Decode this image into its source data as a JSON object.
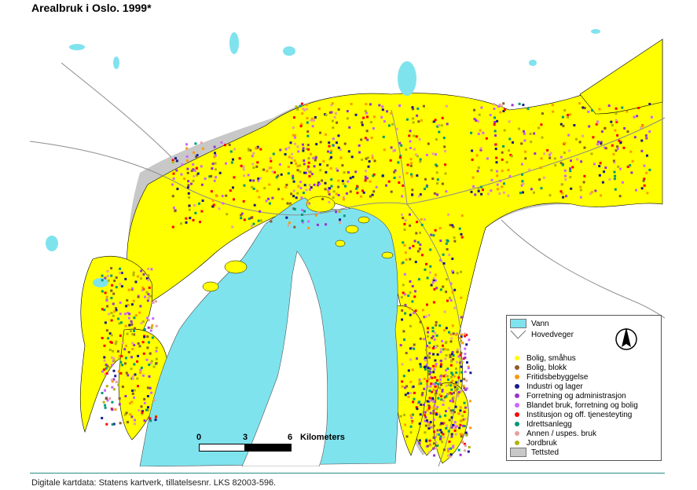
{
  "title": "Arealbruk i Oslo. 1999*",
  "footer": "Digitale kartdata: Statens kartverk, tillatelsesnr. LKS 82003-596.",
  "colors": {
    "water": "#7fe3ee",
    "urban": "#c8c8c8",
    "road": "#9a9a9a",
    "rule": "#2a8a86"
  },
  "legend": {
    "water": "Vann",
    "roads": "Hovedveger",
    "items": [
      {
        "label": "Bolig, småhus",
        "color": "#ffff00"
      },
      {
        "label": "Bolig, blokk",
        "color": "#8b5a2b"
      },
      {
        "label": "Fritidsbebyggelse",
        "color": "#ff9900"
      },
      {
        "label": "Industri og lager",
        "color": "#1a1a8c"
      },
      {
        "label": "Forretning og administrasjon",
        "color": "#9933cc"
      },
      {
        "label": "Blandet bruk, forretning og bolig",
        "color": "#cc66ff"
      },
      {
        "label": "Institusjon og off. tjenesteyting",
        "color": "#ff0000"
      },
      {
        "label": "Idrettsanlegg",
        "color": "#00997a"
      },
      {
        "label": "Annen / uspes. bruk",
        "color": "#e8a0a0"
      },
      {
        "label": "Jordbruk",
        "color": "#b3b300"
      },
      {
        "label": "Tettsted",
        "color": "#c8c8c8"
      }
    ]
  },
  "scalebar": {
    "ticks": [
      "0",
      "3",
      "6"
    ],
    "unit": "Kilometers"
  },
  "north_arrow": "north-arrow"
}
